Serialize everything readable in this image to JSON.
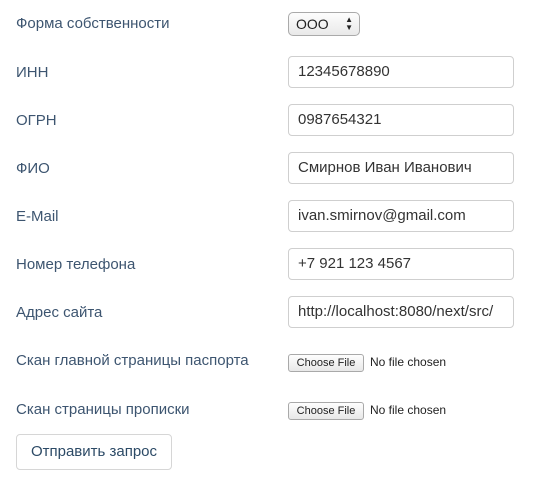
{
  "form": {
    "ownership": {
      "label": "Форма собственности",
      "value": "ООО"
    },
    "inn": {
      "label": "ИНН",
      "value": "12345678890"
    },
    "ogrn": {
      "label": "ОГРН",
      "value": "0987654321"
    },
    "fio": {
      "label": "ФИО",
      "value": "Смирнов Иван Иванович"
    },
    "email": {
      "label": "E-Mail",
      "value": "ivan.smirnov@gmail.com"
    },
    "phone": {
      "label": "Номер телефона",
      "value": "+7 921 123 4567"
    },
    "site": {
      "label": "Адрес сайта",
      "value": "http://localhost:8080/next/src/"
    },
    "passport_scan": {
      "label": "Скан главной страницы паспорта",
      "button": "Choose File",
      "status": "No file chosen"
    },
    "registration_scan": {
      "label": "Скан страницы прописки",
      "button": "Choose File",
      "status": "No file chosen"
    },
    "submit_label": "Отправить запрос"
  }
}
